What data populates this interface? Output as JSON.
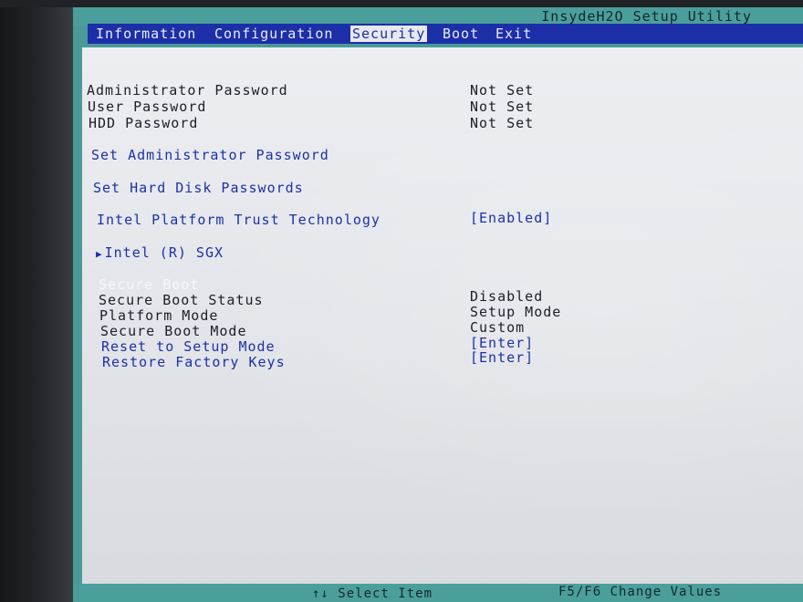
{
  "app": {
    "title": "InsydeH2O Setup Utility"
  },
  "menu": {
    "tabs": [
      {
        "label": "Information"
      },
      {
        "label": "Configuration"
      },
      {
        "label": "Security"
      },
      {
        "label": "Boot"
      },
      {
        "label": "Exit"
      }
    ],
    "active": "Security"
  },
  "security": {
    "passwords": [
      {
        "label": "Administrator Password",
        "value": "Not Set"
      },
      {
        "label": "User Password",
        "value": "Not Set"
      },
      {
        "label": "HDD Password",
        "value": "Not Set"
      }
    ],
    "set_admin_password": "Set Administrator Password",
    "set_hdd_passwords": "Set Hard Disk Passwords",
    "ptt": {
      "label": "Intel Platform Trust Technology",
      "value": "[Enabled]"
    },
    "sgx": {
      "label": "Intel (R) SGX",
      "icon": "submenu-arrow-icon"
    },
    "secure_boot": {
      "header": "Secure Boot",
      "status": {
        "label": "Secure Boot Status",
        "value": "Disabled"
      },
      "platform_mode": {
        "label": "Platform Mode",
        "value": "Setup Mode"
      },
      "mode": {
        "label": "Secure Boot Mode",
        "value": "Custom"
      },
      "reset": {
        "label": "Reset to Setup Mode",
        "value": "[Enter]"
      },
      "restore": {
        "label": "Restore Factory Keys",
        "value": "[Enter]"
      }
    }
  },
  "footer": {
    "left_hint": "↑↓ Select Item",
    "right_hint": "F5/F6 Change Values"
  },
  "colors": {
    "title_bar": "#4a9f9c",
    "menu_bar": "#1c2fa8",
    "active_tab_bg": "#e7e9ee",
    "panel_bg": "#e3e5ea",
    "link_text": "#1d31a6"
  }
}
